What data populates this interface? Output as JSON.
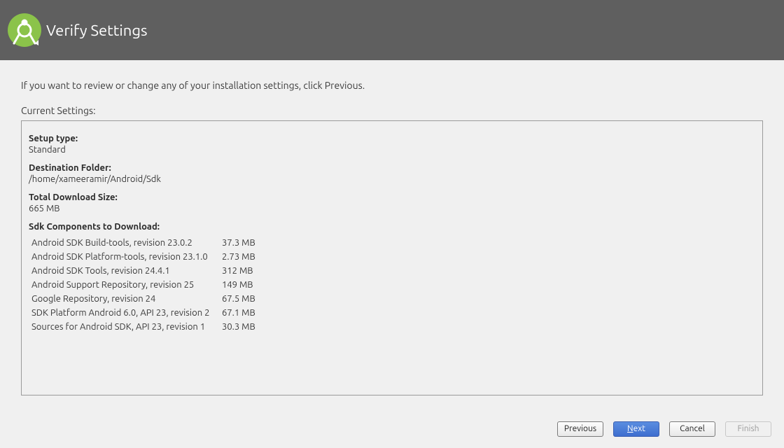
{
  "header": {
    "title": "Verify Settings"
  },
  "instructions": "If you want to review or change any of your installation settings, click Previous.",
  "settings_label": "Current Settings:",
  "setup_type": {
    "label": "Setup type:",
    "value": "Standard"
  },
  "destination": {
    "label": "Destination Folder:",
    "value": "/home/xameeramir/Android/Sdk"
  },
  "download_size": {
    "label": "Total Download Size:",
    "value": "665 MB"
  },
  "components": {
    "label": "Sdk Components to Download:",
    "items": [
      {
        "name": "Android SDK Build-tools, revision 23.0.2",
        "size": "37.3 MB"
      },
      {
        "name": "Android SDK Platform-tools, revision 23.1.0",
        "size": "2.73 MB"
      },
      {
        "name": "Android SDK Tools, revision 24.4.1",
        "size": "312 MB"
      },
      {
        "name": "Android Support Repository, revision 25",
        "size": "149 MB"
      },
      {
        "name": "Google Repository, revision 24",
        "size": "67.5 MB"
      },
      {
        "name": "SDK Platform Android 6.0, API 23, revision 2",
        "size": "67.1 MB"
      },
      {
        "name": "Sources for Android SDK, API 23, revision 1",
        "size": "30.3 MB"
      }
    ]
  },
  "buttons": {
    "previous": "Previous",
    "next_prefix": "N",
    "next_rest": "ext",
    "cancel": "Cancel",
    "finish": "Finish"
  }
}
